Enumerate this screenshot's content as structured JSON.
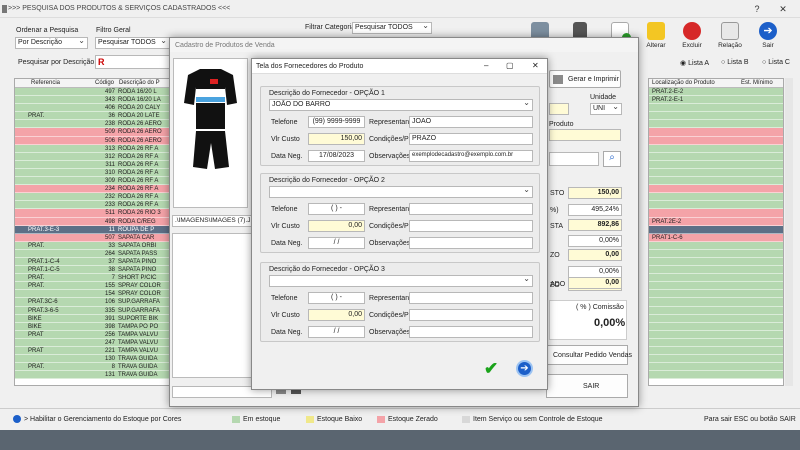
{
  "window_title": ">>> PESQUISA DOS PRODUTOS & SERVIÇOS CADASTRADOS <<<",
  "filters": {
    "ordenar_label": "Ordenar a Pesquisa",
    "ordenar_value": "Por Descrição",
    "filtro_label": "Filtro Geral",
    "filtro_value": "Pesquisar TODOS",
    "categoria_label": "Filtrar Categoria",
    "categoria_value": "Pesquisar TODOS",
    "search_label": "Pesquisar por Descrição",
    "search_value": "R"
  },
  "toolbar": {
    "alterar": "Alterar",
    "excluir": "Excluir",
    "relacao": "Relação",
    "sair": "Sair"
  },
  "lista": {
    "a": "Lista A",
    "b": "Lista B",
    "c": "Lista C"
  },
  "grid": {
    "col_ref": "Referencia",
    "col_cod": "Código",
    "col_desc": "Descrição do P",
    "col_loc": "Localização do Produto",
    "col_min": "Est. Mínimo"
  },
  "rows": [
    {
      "ref": "",
      "cod": "497",
      "desc": "RODA 16/20 L",
      "loc": "PRAT.2-E-2",
      "c": "g"
    },
    {
      "ref": "",
      "cod": "343",
      "desc": "RODA 16/20 LA",
      "loc": "PRAT.2-E-1",
      "c": "g"
    },
    {
      "ref": "",
      "cod": "406",
      "desc": "RODA 20 CALY",
      "loc": "",
      "c": "g"
    },
    {
      "ref": "PRAT.",
      "cod": "36",
      "desc": "RODA 20 LATE",
      "loc": "",
      "c": "g"
    },
    {
      "ref": "",
      "cod": "238",
      "desc": "RODA 26 AERO",
      "loc": "",
      "c": "g"
    },
    {
      "ref": "",
      "cod": "509",
      "desc": "RODA 26 AERO",
      "loc": "",
      "c": "r"
    },
    {
      "ref": "",
      "cod": "506",
      "desc": "RODA 26 AERO",
      "loc": "",
      "c": "r"
    },
    {
      "ref": "",
      "cod": "313",
      "desc": "RODA 26 RF A",
      "loc": "",
      "c": "g"
    },
    {
      "ref": "",
      "cod": "312",
      "desc": "RODA 26 RF A",
      "loc": "",
      "c": "g"
    },
    {
      "ref": "",
      "cod": "311",
      "desc": "RODA 26 RF A",
      "loc": "",
      "c": "g"
    },
    {
      "ref": "",
      "cod": "310",
      "desc": "RODA 26 RF A",
      "loc": "",
      "c": "g"
    },
    {
      "ref": "",
      "cod": "309",
      "desc": "RODA 26 RF A",
      "loc": "",
      "c": "g"
    },
    {
      "ref": "",
      "cod": "234",
      "desc": "RODA 26 RF A",
      "loc": "",
      "c": "r"
    },
    {
      "ref": "",
      "cod": "232",
      "desc": "RODA 26 RF A",
      "loc": "",
      "c": "g"
    },
    {
      "ref": "",
      "cod": "233",
      "desc": "RODA 26 RF A",
      "loc": "",
      "c": "g"
    },
    {
      "ref": "",
      "cod": "511",
      "desc": "RODA 26 RIO 3",
      "loc": "",
      "c": "r"
    },
    {
      "ref": "",
      "cod": "498",
      "desc": "RODA C/REG",
      "loc": "PRAT.2E-2",
      "c": "r"
    },
    {
      "ref": "PRAT.3-E-3",
      "cod": "11",
      "desc": "ROUPA DE P",
      "loc": "",
      "c": "s"
    },
    {
      "ref": "",
      "cod": "507",
      "desc": "SAPATA CAR",
      "loc": "PRAT1-C-6",
      "c": "r"
    },
    {
      "ref": "PRAT.",
      "cod": "33",
      "desc": "SAPATA ORBI",
      "loc": "",
      "c": "g"
    },
    {
      "ref": "",
      "cod": "264",
      "desc": "SAPATA PASS",
      "loc": "",
      "c": "g"
    },
    {
      "ref": "PRAT.1-C-4",
      "cod": "37",
      "desc": "SAPATA PINO",
      "loc": "",
      "c": "g"
    },
    {
      "ref": "PRAT.1-C-5",
      "cod": "38",
      "desc": "SAPATA PINO",
      "loc": "",
      "c": "g"
    },
    {
      "ref": "PRAT.",
      "cod": "7",
      "desc": "SHORT P/CIC",
      "loc": "",
      "c": "g"
    },
    {
      "ref": "PRAT.",
      "cod": "155",
      "desc": "SPRAY COLOR",
      "loc": "",
      "c": "g"
    },
    {
      "ref": "",
      "cod": "154",
      "desc": "SPRAY COLOR",
      "loc": "",
      "c": "g"
    },
    {
      "ref": "PRAT.3C-6",
      "cod": "106",
      "desc": "SUP.GARRAFA",
      "loc": "",
      "c": "g"
    },
    {
      "ref": "PRAT.3-6-5",
      "cod": "335",
      "desc": "SUP.GARRAFA",
      "loc": "",
      "c": "g"
    },
    {
      "ref": "BIKE",
      "cod": "391",
      "desc": "SUPORTE BIK",
      "loc": "",
      "c": "g"
    },
    {
      "ref": "BIKE",
      "cod": "398",
      "desc": "TAMPA PO PO",
      "loc": "",
      "c": "g"
    },
    {
      "ref": "PRAT",
      "cod": "256",
      "desc": "TAMPA VALVU",
      "loc": "",
      "c": "g"
    },
    {
      "ref": "",
      "cod": "247",
      "desc": "TAMPA VALVU",
      "loc": "",
      "c": "g"
    },
    {
      "ref": "PRAT",
      "cod": "221",
      "desc": "TAMPA VALVU",
      "loc": "",
      "c": "g"
    },
    {
      "ref": "",
      "cod": "130",
      "desc": "TRAVA GUIDA",
      "loc": "",
      "c": "g"
    },
    {
      "ref": "PRAT.",
      "cod": "8",
      "desc": "TRAVA GUIDA",
      "loc": "",
      "c": "g"
    },
    {
      "ref": "",
      "cod": "131",
      "desc": "TRAVA GUIDA",
      "loc": "",
      "c": "g"
    }
  ],
  "status": {
    "habilitar": "> Habilitar o Gerenciamento do Estoque por Cores",
    "em_estoque": "Em estoque",
    "baixo": "Estoque Baixo",
    "zerado": "Estoque Zerado",
    "servico": "Item Serviço ou sem Controle de Estoque",
    "sair_hint": "Para sair ESC ou botão SAIR"
  },
  "cadastro": {
    "title": "Cadastro de Produtos de Venda",
    "image_path": ".\\IMAGENS\\IMAGES (7).JP",
    "gerar": "Gerar e Imprimir",
    "unidade_label": "Unidade",
    "unidade": "UNI",
    "produto_label": "Produto",
    "custo_label": "STO",
    "custo": "150,00",
    "pct_label": "%)",
    "pct": "495,24%",
    "vista_label": "STA",
    "vista": "892,86",
    "r1": "0,00%",
    "r2_label": "ZO",
    "r2": "0,00",
    "r3": "0,00%",
    "r4_label": "ZO",
    "r4": "0,00",
    "r5_label": "ADO",
    "r5": "0,00",
    "comissao_label": "( % ) Comissão",
    "comissao": "0,00%",
    "consultar": "Consultar Pedido Vendas",
    "sair": "SAIR"
  },
  "fornec": {
    "title": "Tela dos Fornecedores do Produto",
    "blocks": [
      {
        "title": "Descrição do Fornecedor - OPÇÃO 1",
        "nome": "JOÃO DO BARRO",
        "telefone": "(99) 9999-9999",
        "custo": "150,00",
        "data": "17/08/2023",
        "representante": "JOAO",
        "condicoes": "PRAZO",
        "obs": "exemplodecadastro@exemplo.com.br"
      },
      {
        "title": "Descrição do Fornecedor - OPÇÃO 2",
        "nome": "",
        "telefone": "(   )    -",
        "custo": "0,00",
        "data": "/  /",
        "representante": "",
        "condicoes": "",
        "obs": ""
      },
      {
        "title": "Descrição do Fornecedor - OPÇÃO 3",
        "nome": "",
        "telefone": "(   )    -",
        "custo": "0,00",
        "data": "/  /",
        "representante": "",
        "condicoes": "",
        "obs": ""
      }
    ],
    "l_tel": "Telefone",
    "l_custo": "Vlr Custo",
    "l_data": "Data Neg.",
    "l_rep": "Representante",
    "l_cond": "Condições/Prz",
    "l_obs": "Observações"
  },
  "colors": {
    "green": "#b5d8b0",
    "red": "#f4a3a8",
    "yellow": "#fffbd6",
    "selected": "#5d6f86",
    "confirm": "#1aa31a",
    "next": "#1c5fc9"
  }
}
